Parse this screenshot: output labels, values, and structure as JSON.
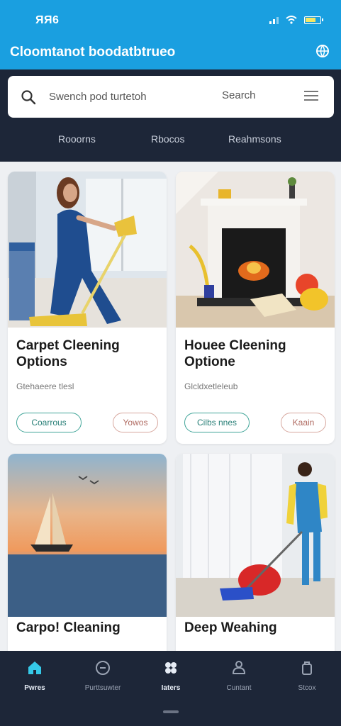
{
  "status_bar": {
    "time": "ЯЯ6"
  },
  "app_bar": {
    "title": "Cloomtanot boodatbtrueo"
  },
  "search": {
    "placeholder": "Swench pod turtetoh",
    "button_label": "Search"
  },
  "tabs": [
    "Rooorns",
    "Rbocos",
    "Reahmsons"
  ],
  "cards": [
    {
      "title": "Carpet Cleening Options",
      "meta": "Gtehaeere tlesl",
      "primary_action": "Coarrous",
      "secondary_action": "Yowos"
    },
    {
      "title": "Houee Cleening Optione",
      "meta": "Glcldxetleleub",
      "primary_action": "Cilbs nnes",
      "secondary_action": "Kaain"
    },
    {
      "title": "Carpo! Cleaning",
      "meta": "",
      "primary_action": "",
      "secondary_action": ""
    },
    {
      "title": "Deep Weahing",
      "meta": "",
      "primary_action": "",
      "secondary_action": ""
    }
  ],
  "bottom_nav": [
    {
      "label": "Pwres",
      "icon": "home-icon",
      "active": true
    },
    {
      "label": "Purttsuwter",
      "icon": "clock-icon",
      "active": false
    },
    {
      "label": "Iaters",
      "icon": "grid-icon",
      "active": true
    },
    {
      "label": "Cuntant",
      "icon": "contact-icon",
      "active": false
    },
    {
      "label": "Stcox",
      "icon": "bag-icon",
      "active": false
    }
  ],
  "colors": {
    "accent": "#1a9fe0",
    "dark_panel": "#1d2638",
    "home_active": "#35c9e8",
    "pill_primary": "#3fa498",
    "pill_secondary": "#d7a79e"
  }
}
